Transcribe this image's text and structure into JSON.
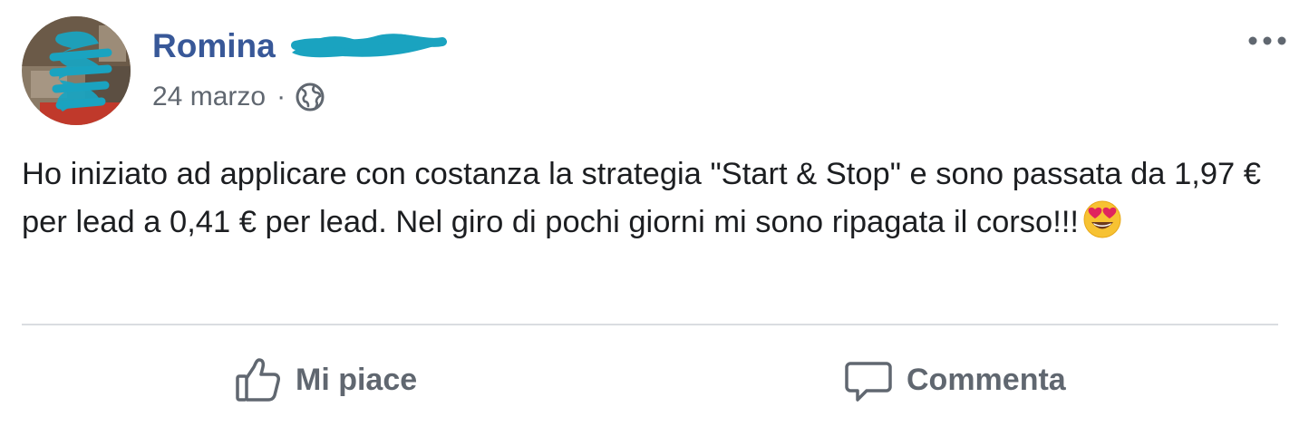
{
  "post": {
    "author_name": "Romina",
    "timestamp": "24 marzo",
    "separator": "·",
    "audience_icon": "globe-icon",
    "more_icon": "more-options-icon",
    "text": "Ho iniziato ad applicare con costanza la strategia \"Start & Stop\" e sono passata da 1,97 € per lead a 0,41 € per lead. Nel giro di pochi giorni mi sono ripagata il corso!!!",
    "emoji": "smiling-face-with-heart-eyes-icon"
  },
  "actions": {
    "like_label": "Mi piace",
    "like_icon": "thumbs-up-icon",
    "comment_label": "Commenta",
    "comment_icon": "comment-bubble-icon"
  },
  "colors": {
    "author_name": "#385898",
    "secondary_text": "#606770",
    "body_text": "#1c1e21",
    "divider": "#dadde1",
    "redaction_scribble": "#1aa3c0"
  }
}
